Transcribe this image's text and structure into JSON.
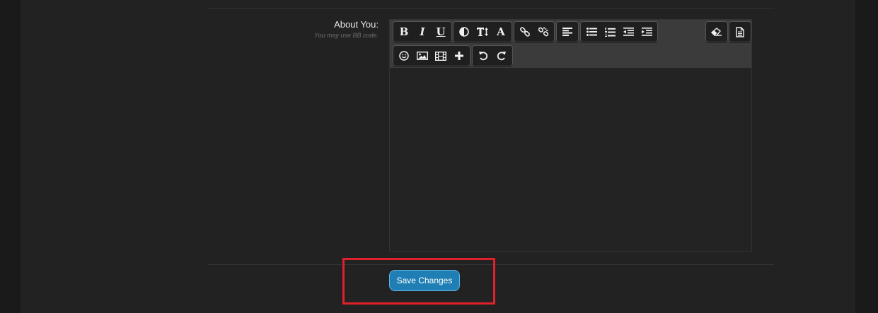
{
  "form": {
    "label": "About You:",
    "hint": "You may use BB code.",
    "save_label": "Save Changes"
  },
  "toolbar": {
    "bold": "B",
    "italic": "I",
    "underline": "U",
    "font_family": "A"
  },
  "colors": {
    "accent": "#1f7fb4",
    "highlight": "#e0202a"
  },
  "icons": [
    "bold-icon",
    "italic-icon",
    "underline-icon",
    "color-icon",
    "font-size-icon",
    "font-family-icon",
    "link-icon",
    "unlink-icon",
    "align-icon",
    "bullet-list-icon",
    "numbered-list-icon",
    "outdent-icon",
    "indent-icon",
    "eraser-icon",
    "source-icon",
    "smiley-icon",
    "image-icon",
    "media-icon",
    "insert-icon",
    "undo-icon",
    "redo-icon"
  ]
}
